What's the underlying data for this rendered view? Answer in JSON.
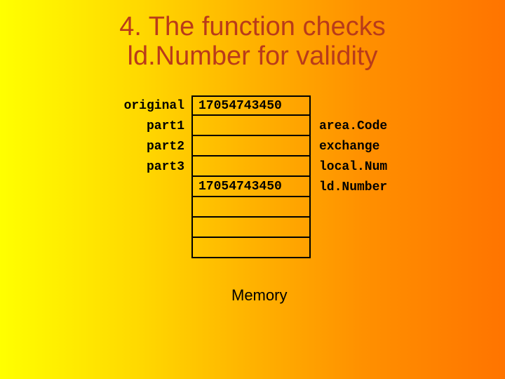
{
  "title_line1": "4. The function checks",
  "title_line2": "ld.Number for validity",
  "left_labels": {
    "r0": "original",
    "r1": "part1",
    "r2": "part2",
    "r3": "part3"
  },
  "cell_values": {
    "r0": "17054743450",
    "r1": "",
    "r2": "",
    "r3": "",
    "r4": "17054743450",
    "r5": "",
    "r6": "",
    "r7": ""
  },
  "right_labels": {
    "r1": "area.Code",
    "r2": "exchange",
    "r3": "local.Num",
    "r4": "ld.Number"
  },
  "memory_caption": "Memory"
}
